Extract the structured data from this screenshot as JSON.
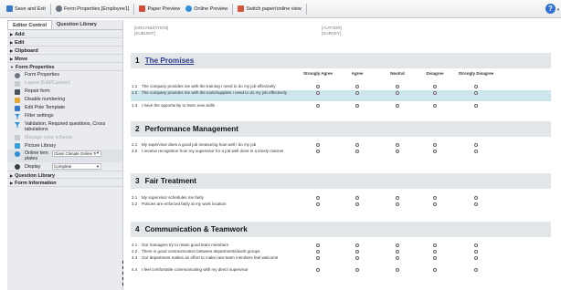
{
  "toolbar": {
    "save_exit": "Save and Exit",
    "form_properties": "Form Properties [Employee1]",
    "paper_preview": "Paper Preview",
    "online_preview": "Online Preview",
    "switch_view": "Switch paper/online view",
    "help": "?"
  },
  "sidebar": {
    "tabs": [
      "Editor Control",
      "Question Library"
    ],
    "sections_top": [
      "Add",
      "Edit",
      "Clipboard",
      "Move"
    ],
    "form_properties": "Form Properties",
    "items": [
      {
        "label": "Form Properties",
        "disabled": false
      },
      {
        "label": "Layout (Edit/Custom)",
        "disabled": true
      },
      {
        "label": "Repair form",
        "disabled": false
      },
      {
        "label": "Disable numbering",
        "disabled": false
      },
      {
        "label": "Edit Pole Template",
        "disabled": false
      },
      {
        "label": "Filter settings",
        "disabled": false
      },
      {
        "label": "Validation, Required questions, Cross tabulations",
        "disabled": false
      },
      {
        "label": "Manage color scheme",
        "disabled": true
      },
      {
        "label": "Picture Library",
        "disabled": false
      }
    ],
    "online_item": {
      "label": "Online tem plates",
      "select": "Class Climate Online Tem"
    },
    "display_item": {
      "label": "Display",
      "select": "Complete"
    },
    "sections_bottom": [
      "Question Library",
      "Form Information"
    ]
  },
  "form": {
    "placeholders_left": [
      "[ORGANIZATION]",
      "[SUBUNIT]"
    ],
    "placeholders_right": [
      "[AUTHOR]",
      "[SURVEY]"
    ],
    "column_headers": [
      "Strongly Agree",
      "Agree",
      "Neutral",
      "Disagree",
      "Strongly Disagree"
    ],
    "sections": [
      {
        "num": "1",
        "title": "The Promises",
        "questions": [
          {
            "num": "1.1",
            "text": "The company provides me with the training I need to do my job effectively"
          },
          {
            "num": "1.2",
            "text": "The company provides me with the tools/supplies I need to do my job effectively"
          },
          {
            "num": "1.3",
            "text": "I have the opportunity to learn new skills"
          }
        ]
      },
      {
        "num": "2",
        "title": "Performance Management",
        "questions": [
          {
            "num": "2.1",
            "text": "My supervisor does a good job measuring how well I do my job"
          },
          {
            "num": "2.2",
            "text": "I receive recognition from my supervisor for a job well done in a timely manner"
          }
        ]
      },
      {
        "num": "3",
        "title": "Fair Treatment",
        "questions": [
          {
            "num": "3.1",
            "text": "My supervisor schedules me fairly"
          },
          {
            "num": "3.2",
            "text": "Policies are enforced fairly at my work location"
          }
        ]
      },
      {
        "num": "4",
        "title": "Communication & Teamwork",
        "questions": [
          {
            "num": "4.1",
            "text": "Our managers try to retain good team members"
          },
          {
            "num": "4.2",
            "text": "There is good communication between departments/work groups"
          },
          {
            "num": "4.3",
            "text": "Our department makes an effort to make new team members feel welcome"
          },
          {
            "num": "4.4",
            "text": "I feel comfortable communicating with my direct supervisor"
          }
        ]
      }
    ]
  }
}
